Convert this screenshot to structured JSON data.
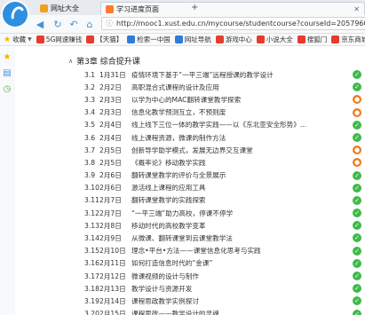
{
  "browser": {
    "tabs": [
      {
        "label": "网址大全",
        "icon": "folder-icon"
      },
      {
        "label": "学习进度页面",
        "icon": "page-icon"
      }
    ],
    "url": "http://mooc1.xust.edu.cn/mycourse/studentcourse?courseId=205796018&clazz",
    "bookmarks": [
      {
        "label": "收藏",
        "color": "#f0b400"
      },
      {
        "label": "5G网速赚钱",
        "color": "#e63b2e"
      },
      {
        "label": "【天猫】",
        "color": "#e63b2e"
      },
      {
        "label": "检索一中国",
        "color": "#2f7bd6"
      },
      {
        "label": "网址导航",
        "color": "#2f7bd6"
      },
      {
        "label": "游戏中心",
        "color": "#e63b2e"
      },
      {
        "label": "小说大全",
        "color": "#e63b2e"
      },
      {
        "label": "搜狐门",
        "color": "#e63b2e"
      },
      {
        "label": "京东商城",
        "color": "#e63b2e"
      }
    ]
  },
  "chapter": {
    "label": "第3章 综合提升课"
  },
  "lessons": [
    {
      "num": "3.1",
      "date": "1月31日",
      "title": "疫情环境下基于“一平三端”远程授课的教学设计",
      "status": "done"
    },
    {
      "num": "3.2",
      "date": "2月2日",
      "title": "高职混合式课程的设计及应用",
      "status": "done"
    },
    {
      "num": "3.3",
      "date": "2月3日",
      "title": "以学为中心的MAC翻转课堂教学探索",
      "status": "warn"
    },
    {
      "num": "3.4",
      "date": "2月3日",
      "title": "信息化教学预测互立，不预则废",
      "status": "warn"
    },
    {
      "num": "3.5",
      "date": "2月4日",
      "title": "线上线下三位一体的教学实践——以《东北亚安全形势》...",
      "status": "done"
    },
    {
      "num": "3.6",
      "date": "2月4日",
      "title": "线上课程资源，微课的制作方法",
      "status": "done"
    },
    {
      "num": "3.7",
      "date": "2月5日",
      "title": "创新导学助学模式，发展无边界交互课堂",
      "status": "warn"
    },
    {
      "num": "3.8",
      "date": "2月5日",
      "title": "《概率论》移动教学实践",
      "status": "warn"
    },
    {
      "num": "3.9",
      "date": "2月6日",
      "title": "翻转课堂教学的评价与全景展示",
      "status": "done"
    },
    {
      "num": "3.10",
      "date": "2月6日",
      "title": "激活线上课程的应用工具",
      "status": "done"
    },
    {
      "num": "3.11",
      "date": "2月7日",
      "title": "翻转课堂教学的实践探索",
      "status": "done"
    },
    {
      "num": "3.12",
      "date": "2月7日",
      "title": "“一平三端”助力高校，停课不停学",
      "status": "done"
    },
    {
      "num": "3.13",
      "date": "2月8日",
      "title": "移动时代的高校教学变革",
      "status": "done"
    },
    {
      "num": "3.14",
      "date": "2月9日",
      "title": "从微课、翻转课堂到云课堂教学法",
      "status": "done"
    },
    {
      "num": "3.15",
      "date": "2月10日",
      "title": "理念•平台•方法——课堂信息化思考与实践",
      "status": "done"
    },
    {
      "num": "3.16",
      "date": "2月11日",
      "title": "如何打造信息时代的“金课”",
      "status": "done"
    },
    {
      "num": "3.17",
      "date": "2月12日",
      "title": "微课视频的设计与制作",
      "status": "done"
    },
    {
      "num": "3.18",
      "date": "2月13日",
      "title": "教学设计与资源开发",
      "status": "done"
    },
    {
      "num": "3.19",
      "date": "2月14日",
      "title": "课程思政教学实例探讨",
      "status": "done"
    },
    {
      "num": "3.20",
      "date": "2月15日",
      "title": "课程思政——教学设计的灵魂",
      "status": "done"
    }
  ],
  "colors": {
    "done": "#41b94a",
    "warn": "#f07a1a"
  }
}
